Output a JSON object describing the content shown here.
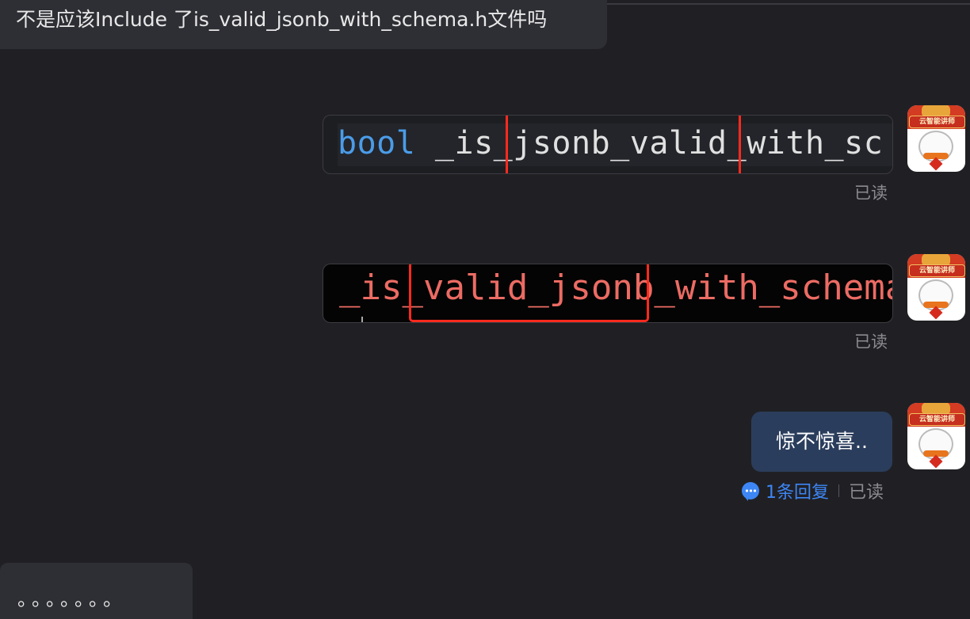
{
  "messages": {
    "incoming_1": "不是应该Include 了is_valid_jsonb_with_schema.h文件吗",
    "incoming_2": "。。。。。。。",
    "outgoing_text": "惊不惊喜.."
  },
  "code_snippets": {
    "snippet_1": {
      "keyword": "bool",
      "rest": " _is_jsonb_valid_with_sc"
    },
    "snippet_2": {
      "text": "_is_valid_jsonb_with_schema("
    }
  },
  "status": {
    "read_label": "已读",
    "reply_count_label": "1条回复"
  },
  "avatar": {
    "banner_text": "云智能讲师"
  },
  "colors": {
    "background": "#202024",
    "incoming_bubble": "#2e2f34",
    "outgoing_bubble": "#2b3d5c",
    "highlight_box": "#ff2a1e",
    "link_blue": "#3d86f5"
  }
}
